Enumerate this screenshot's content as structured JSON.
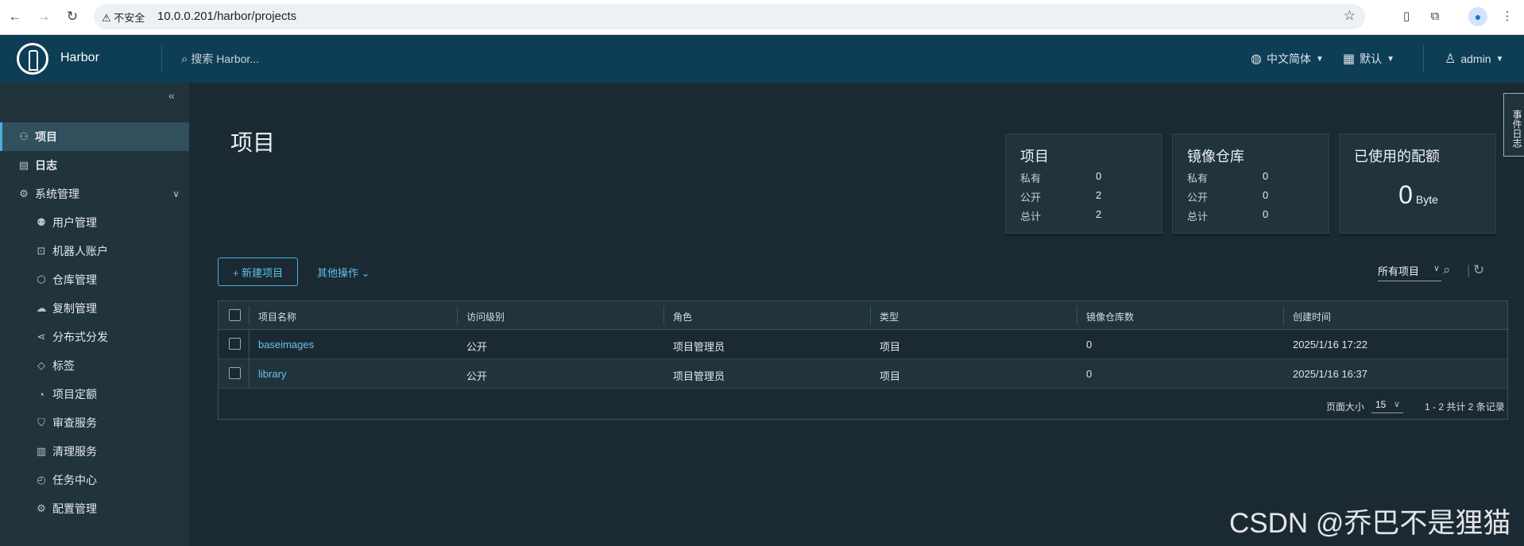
{
  "browser": {
    "security_label": "⚠ 不安全",
    "url": "10.0.0.201/harbor/projects"
  },
  "header": {
    "brand": "Harbor",
    "search_placeholder": "搜索 Harbor...",
    "language": "中文简体",
    "theme": "默认",
    "user": "admin"
  },
  "sidebar": {
    "items": [
      {
        "label": "项目",
        "icon": "projects-icon",
        "active": true
      },
      {
        "label": "日志",
        "icon": "logs-icon"
      },
      {
        "label": "系统管理",
        "icon": "admin-icon",
        "expanded": true
      }
    ],
    "sub_items": [
      {
        "label": "用户管理",
        "icon": "users-icon"
      },
      {
        "label": "机器人账户",
        "icon": "robot-icon"
      },
      {
        "label": "仓库管理",
        "icon": "registry-icon"
      },
      {
        "label": "复制管理",
        "icon": "replication-icon"
      },
      {
        "label": "分布式分发",
        "icon": "distribution-icon"
      },
      {
        "label": "标签",
        "icon": "tag-icon"
      },
      {
        "label": "项目定额",
        "icon": "quota-icon"
      },
      {
        "label": "审查服务",
        "icon": "shield-icon"
      },
      {
        "label": "清理服务",
        "icon": "trash-icon"
      },
      {
        "label": "任务中心",
        "icon": "tasks-icon"
      },
      {
        "label": "配置管理",
        "icon": "gear-icon"
      }
    ]
  },
  "main": {
    "title": "项目",
    "cards": [
      {
        "title": "项目",
        "rows": [
          {
            "label": "私有",
            "value": "0"
          },
          {
            "label": "公开",
            "value": "2"
          },
          {
            "label": "总计",
            "value": "2"
          }
        ]
      },
      {
        "title": "镜像仓库",
        "rows": [
          {
            "label": "私有",
            "value": "0"
          },
          {
            "label": "公开",
            "value": "0"
          },
          {
            "label": "总计",
            "value": "0"
          }
        ]
      },
      {
        "title": "已使用的配额",
        "value": "0",
        "unit": "Byte"
      }
    ],
    "new_project_label": "+ 新建项目",
    "other_actions_label": "其他操作",
    "filter_label": "所有项目",
    "table": {
      "columns": [
        "项目名称",
        "访问级别",
        "角色",
        "类型",
        "镜像仓库数",
        "创建时间"
      ],
      "rows": [
        [
          "baseimages",
          "公开",
          "项目管理员",
          "项目",
          "0",
          "2025/1/16 17:22"
        ],
        [
          "library",
          "公开",
          "项目管理员",
          "项目",
          "0",
          "2025/1/16 16:37"
        ]
      ],
      "page_size_label": "页面大小",
      "page_size": "15",
      "count_text": "1 - 2 共计 2 条记录"
    }
  },
  "side_tab": "事件日志",
  "watermark": "CSDN @乔巴不是狸猫",
  "colors": {
    "header_bg": "#0e3d56",
    "sidebar_bg": "#21333b",
    "main_bg": "#1b2a32",
    "accent": "#49afd9"
  }
}
